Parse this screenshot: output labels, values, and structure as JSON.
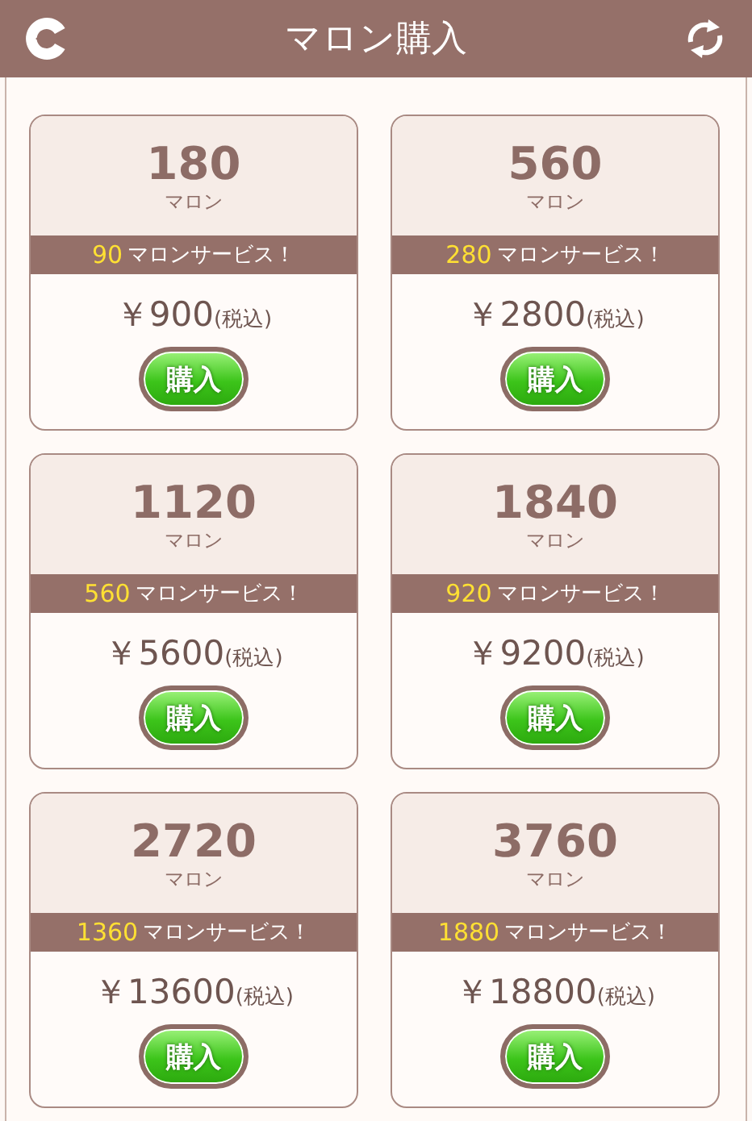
{
  "header": {
    "title": "マロン購入"
  },
  "products": [
    {
      "amount": "180",
      "unit": "マロン",
      "bonus": "90",
      "bonus_text": "マロンサービス！",
      "price": "￥900",
      "tax": "(税込)",
      "button": "購入"
    },
    {
      "amount": "560",
      "unit": "マロン",
      "bonus": "280",
      "bonus_text": "マロンサービス！",
      "price": "￥2800",
      "tax": "(税込)",
      "button": "購入"
    },
    {
      "amount": "1120",
      "unit": "マロン",
      "bonus": "560",
      "bonus_text": "マロンサービス！",
      "price": "￥5600",
      "tax": "(税込)",
      "button": "購入"
    },
    {
      "amount": "1840",
      "unit": "マロン",
      "bonus": "920",
      "bonus_text": "マロンサービス！",
      "price": "￥9200",
      "tax": "(税込)",
      "button": "購入"
    },
    {
      "amount": "2720",
      "unit": "マロン",
      "bonus": "1360",
      "bonus_text": "マロンサービス！",
      "price": "￥13600",
      "tax": "(税込)",
      "button": "購入"
    },
    {
      "amount": "3760",
      "unit": "マロン",
      "bonus": "1880",
      "bonus_text": "マロンサービス！",
      "price": "￥18800",
      "tax": "(税込)",
      "button": "購入"
    }
  ]
}
